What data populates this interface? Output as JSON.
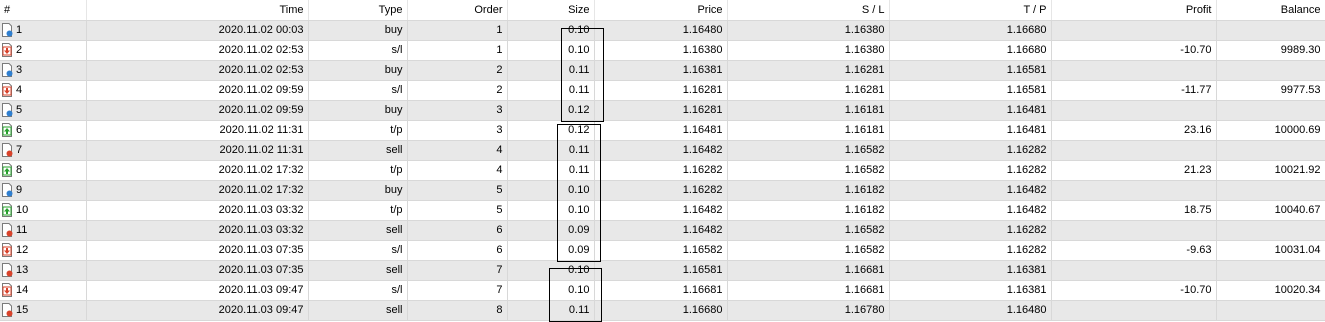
{
  "columns": [
    "#",
    "Time",
    "Type",
    "Order",
    "Size",
    "Price",
    "S / L",
    "T / P",
    "Profit",
    "Balance"
  ],
  "rows": [
    {
      "n": "1",
      "time": "2020.11.02 00:03",
      "type": "buy",
      "order": "1",
      "size": "0.10",
      "price": "1.16480",
      "sl": "1.16380",
      "tp": "1.16680",
      "profit": "",
      "balance": "",
      "icon": "buy-order-icon"
    },
    {
      "n": "2",
      "time": "2020.11.02 02:53",
      "type": "s/l",
      "order": "1",
      "size": "0.10",
      "price": "1.16380",
      "sl": "1.16380",
      "tp": "1.16680",
      "profit": "-10.70",
      "balance": "9989.30",
      "icon": "stop-loss-icon"
    },
    {
      "n": "3",
      "time": "2020.11.02 02:53",
      "type": "buy",
      "order": "2",
      "size": "0.11",
      "price": "1.16381",
      "sl": "1.16281",
      "tp": "1.16581",
      "profit": "",
      "balance": "",
      "icon": "buy-order-icon"
    },
    {
      "n": "4",
      "time": "2020.11.02 09:59",
      "type": "s/l",
      "order": "2",
      "size": "0.11",
      "price": "1.16281",
      "sl": "1.16281",
      "tp": "1.16581",
      "profit": "-11.77",
      "balance": "9977.53",
      "icon": "stop-loss-icon"
    },
    {
      "n": "5",
      "time": "2020.11.02 09:59",
      "type": "buy",
      "order": "3",
      "size": "0.12",
      "price": "1.16281",
      "sl": "1.16181",
      "tp": "1.16481",
      "profit": "",
      "balance": "",
      "icon": "buy-order-icon"
    },
    {
      "n": "6",
      "time": "2020.11.02 11:31",
      "type": "t/p",
      "order": "3",
      "size": "0.12",
      "price": "1.16481",
      "sl": "1.16181",
      "tp": "1.16481",
      "profit": "23.16",
      "balance": "10000.69",
      "icon": "take-profit-icon"
    },
    {
      "n": "7",
      "time": "2020.11.02 11:31",
      "type": "sell",
      "order": "4",
      "size": "0.11",
      "price": "1.16482",
      "sl": "1.16582",
      "tp": "1.16282",
      "profit": "",
      "balance": "",
      "icon": "sell-order-icon"
    },
    {
      "n": "8",
      "time": "2020.11.02 17:32",
      "type": "t/p",
      "order": "4",
      "size": "0.11",
      "price": "1.16282",
      "sl": "1.16582",
      "tp": "1.16282",
      "profit": "21.23",
      "balance": "10021.92",
      "icon": "take-profit-icon"
    },
    {
      "n": "9",
      "time": "2020.11.02 17:32",
      "type": "buy",
      "order": "5",
      "size": "0.10",
      "price": "1.16282",
      "sl": "1.16182",
      "tp": "1.16482",
      "profit": "",
      "balance": "",
      "icon": "buy-order-icon"
    },
    {
      "n": "10",
      "time": "2020.11.03 03:32",
      "type": "t/p",
      "order": "5",
      "size": "0.10",
      "price": "1.16482",
      "sl": "1.16182",
      "tp": "1.16482",
      "profit": "18.75",
      "balance": "10040.67",
      "icon": "take-profit-icon"
    },
    {
      "n": "11",
      "time": "2020.11.03 03:32",
      "type": "sell",
      "order": "6",
      "size": "0.09",
      "price": "1.16482",
      "sl": "1.16582",
      "tp": "1.16282",
      "profit": "",
      "balance": "",
      "icon": "sell-order-icon"
    },
    {
      "n": "12",
      "time": "2020.11.03 07:35",
      "type": "s/l",
      "order": "6",
      "size": "0.09",
      "price": "1.16582",
      "sl": "1.16582",
      "tp": "1.16282",
      "profit": "-9.63",
      "balance": "10031.04",
      "icon": "stop-loss-icon"
    },
    {
      "n": "13",
      "time": "2020.11.03 07:35",
      "type": "sell",
      "order": "7",
      "size": "0.10",
      "price": "1.16581",
      "sl": "1.16681",
      "tp": "1.16381",
      "profit": "",
      "balance": "",
      "icon": "sell-order-icon"
    },
    {
      "n": "14",
      "time": "2020.11.03 09:47",
      "type": "s/l",
      "order": "7",
      "size": "0.10",
      "price": "1.16681",
      "sl": "1.16681",
      "tp": "1.16381",
      "profit": "-10.70",
      "balance": "10020.34",
      "icon": "stop-loss-icon"
    },
    {
      "n": "15",
      "time": "2020.11.03 09:47",
      "type": "sell",
      "order": "8",
      "size": "0.11",
      "price": "1.16680",
      "sl": "1.16780",
      "tp": "1.16480",
      "profit": "",
      "balance": "",
      "icon": "sell-order-icon"
    }
  ],
  "colors": {
    "row_shade": "#e8e8e8",
    "row_plain": "#ffffff",
    "grid": "#d8d8d8",
    "buy": "#2f7fd0",
    "sell": "#d9432b",
    "tp": "#27a12d",
    "sl": "#d9432b"
  }
}
